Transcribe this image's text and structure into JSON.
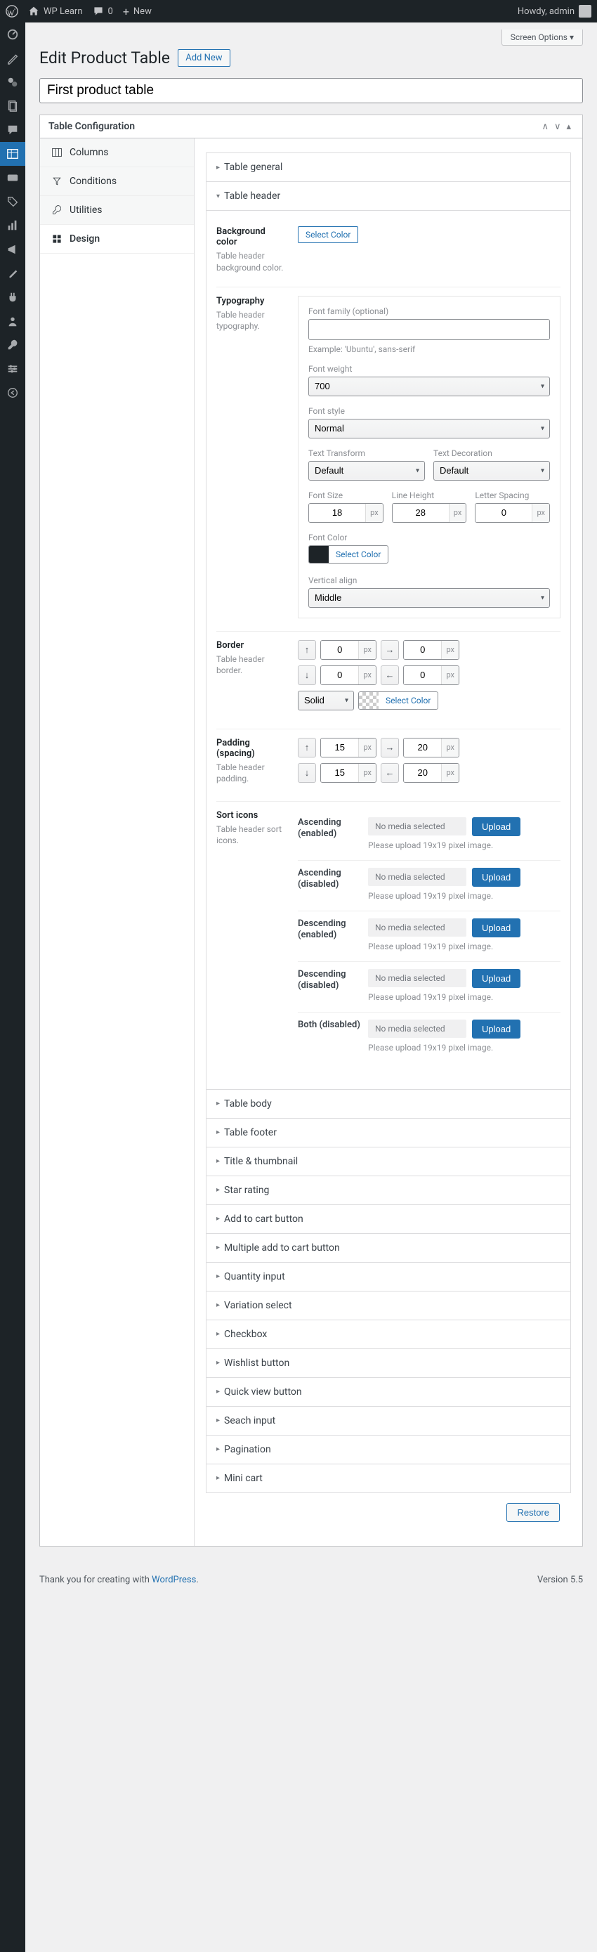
{
  "adminbar": {
    "site": "WP Learn",
    "comments": "0",
    "new": "New",
    "howdy": "Howdy, admin"
  },
  "screen_options": "Screen Options ▾",
  "page": {
    "heading": "Edit Product Table",
    "add_new": "Add New",
    "title_value": "First product table"
  },
  "panel": {
    "title": "Table Configuration",
    "tabs": {
      "columns": "Columns",
      "conditions": "Conditions",
      "utilities": "Utilities",
      "design": "Design"
    }
  },
  "accordions": {
    "table_general": "Table general",
    "table_header": "Table header",
    "table_body": "Table body",
    "table_footer": "Table footer",
    "title_thumb": "Title & thumbnail",
    "star": "Star rating",
    "add_cart": "Add to cart button",
    "multi_cart": "Multiple add to cart button",
    "qty": "Quantity input",
    "variation": "Variation select",
    "checkbox": "Checkbox",
    "wishlist": "Wishlist button",
    "quickview": "Quick view button",
    "search": "Seach input",
    "pagination": "Pagination",
    "minicart": "Mini cart"
  },
  "header": {
    "bg": {
      "label": "Background color",
      "desc": "Table header background color.",
      "btn": "Select Color"
    },
    "typo": {
      "label": "Typography",
      "desc": "Table header typography.",
      "font_family_label": "Font family (optional)",
      "font_family_hint": "Example: 'Ubuntu', sans-serif",
      "font_weight_label": "Font weight",
      "font_weight": "700",
      "font_style_label": "Font style",
      "font_style": "Normal",
      "text_transform_label": "Text Transform",
      "text_transform": "Default",
      "text_decoration_label": "Text Decoration",
      "text_decoration": "Default",
      "font_size_label": "Font Size",
      "font_size": "18",
      "line_height_label": "Line Height",
      "line_height": "28",
      "letter_spacing_label": "Letter Spacing",
      "letter_spacing": "0",
      "font_color_label": "Font Color",
      "font_color_btn": "Select Color",
      "valign_label": "Vertical align",
      "valign": "Middle",
      "px": "px"
    },
    "border": {
      "label": "Border",
      "desc": "Table header border.",
      "top": "0",
      "right": "0",
      "bottom": "0",
      "left": "0",
      "style": "Solid",
      "btn": "Select Color",
      "px": "px"
    },
    "padding": {
      "label": "Padding (spacing)",
      "desc": "Table header padding.",
      "top": "15",
      "right": "20",
      "bottom": "15",
      "left": "20",
      "px": "px"
    },
    "sort": {
      "label": "Sort icons",
      "desc": "Table header sort icons.",
      "asc_en": "Ascending (enabled)",
      "asc_dis": "Ascending (disabled)",
      "desc_en": "Descending (enabled)",
      "desc_dis": "Descending (disabled)",
      "both_dis": "Both (disabled)",
      "no_media": "No media selected",
      "upload": "Upload",
      "hint": "Please upload 19x19 pixel image."
    }
  },
  "restore": "Restore",
  "footer": {
    "thanks_pre": "Thank you for creating with ",
    "wp": "WordPress",
    "thanks_post": ".",
    "version": "Version 5.5"
  }
}
